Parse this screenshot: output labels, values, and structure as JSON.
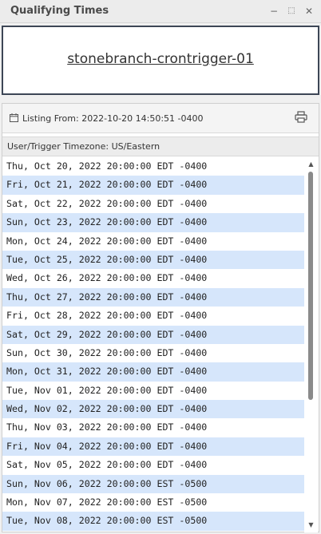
{
  "panel": {
    "title": "Qualifying Times",
    "minimize_icon": "minimize-icon",
    "maximize_icon": "maximize-icon",
    "close_icon": "close-icon"
  },
  "trigger": {
    "name": "stonebranch-crontrigger-01"
  },
  "listing": {
    "from_label": "Listing From: 2022-10-20 14:50:51 -0400",
    "calendar_icon": "calendar-icon",
    "print_icon": "print-icon"
  },
  "timezone": {
    "label": "User/Trigger Timezone: US/Eastern"
  },
  "rows": [
    "Thu, Oct 20, 2022 20:00:00 EDT -0400",
    "Fri, Oct 21, 2022 20:00:00 EDT -0400",
    "Sat, Oct 22, 2022 20:00:00 EDT -0400",
    "Sun, Oct 23, 2022 20:00:00 EDT -0400",
    "Mon, Oct 24, 2022 20:00:00 EDT -0400",
    "Tue, Oct 25, 2022 20:00:00 EDT -0400",
    "Wed, Oct 26, 2022 20:00:00 EDT -0400",
    "Thu, Oct 27, 2022 20:00:00 EDT -0400",
    "Fri, Oct 28, 2022 20:00:00 EDT -0400",
    "Sat, Oct 29, 2022 20:00:00 EDT -0400",
    "Sun, Oct 30, 2022 20:00:00 EDT -0400",
    "Mon, Oct 31, 2022 20:00:00 EDT -0400",
    "Tue, Nov 01, 2022 20:00:00 EDT -0400",
    "Wed, Nov 02, 2022 20:00:00 EDT -0400",
    "Thu, Nov 03, 2022 20:00:00 EDT -0400",
    "Fri, Nov 04, 2022 20:00:00 EDT -0400",
    "Sat, Nov 05, 2022 20:00:00 EDT -0400",
    "Sun, Nov 06, 2022 20:00:00 EST -0500",
    "Mon, Nov 07, 2022 20:00:00 EST -0500",
    "Tue, Nov 08, 2022 20:00:00 EST -0500"
  ],
  "colors": {
    "alt_row": "#d6e6fb",
    "border_dark": "#3d4656"
  }
}
